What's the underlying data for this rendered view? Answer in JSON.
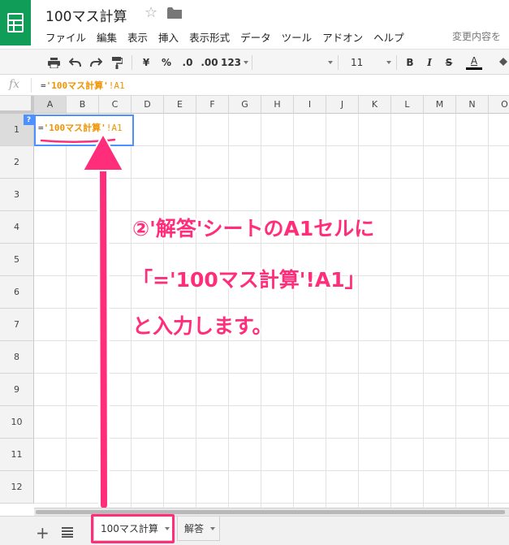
{
  "app": {
    "title": "100マス計算",
    "icons": {
      "logo": "sheets-logo-icon",
      "star": "star-icon",
      "folder": "folder-icon"
    },
    "save_status": "変更内容を"
  },
  "menu": [
    "ファイル",
    "編集",
    "表示",
    "挿入",
    "表示形式",
    "データ",
    "ツール",
    "アドオン",
    "ヘルプ"
  ],
  "toolbar": {
    "currency": "¥",
    "percent": "%",
    "decrease_decimal": ".0",
    "increase_decimal": ".00",
    "number_format": "123",
    "font_size": "11",
    "bold": "B",
    "italic": "I",
    "strikethrough": "S",
    "text_color": "A"
  },
  "formula_bar": {
    "fx": "fx",
    "eq": "=",
    "ref": "'100マス計算'",
    "end": "!A1"
  },
  "grid": {
    "columns": [
      "A",
      "B",
      "C",
      "D",
      "E",
      "F",
      "G",
      "H",
      "I",
      "J",
      "K",
      "L",
      "M",
      "N",
      "O"
    ],
    "rows": [
      "1",
      "2",
      "3",
      "4",
      "5",
      "6",
      "7",
      "8",
      "9",
      "10",
      "11",
      "12"
    ],
    "selected_cell": {
      "help": "?",
      "eq": "=",
      "ref": "'100マス計算'",
      "end": "!A1"
    }
  },
  "annotation": {
    "line1": "②'解答'シートのA1セルに",
    "line2": "「='100マス計算'!A1」",
    "line3": "と入力します。",
    "color": "#ff2d7a"
  },
  "sheets": {
    "add": "+",
    "tabs": [
      {
        "label": "100マス計算"
      },
      {
        "label": "解答"
      }
    ]
  }
}
